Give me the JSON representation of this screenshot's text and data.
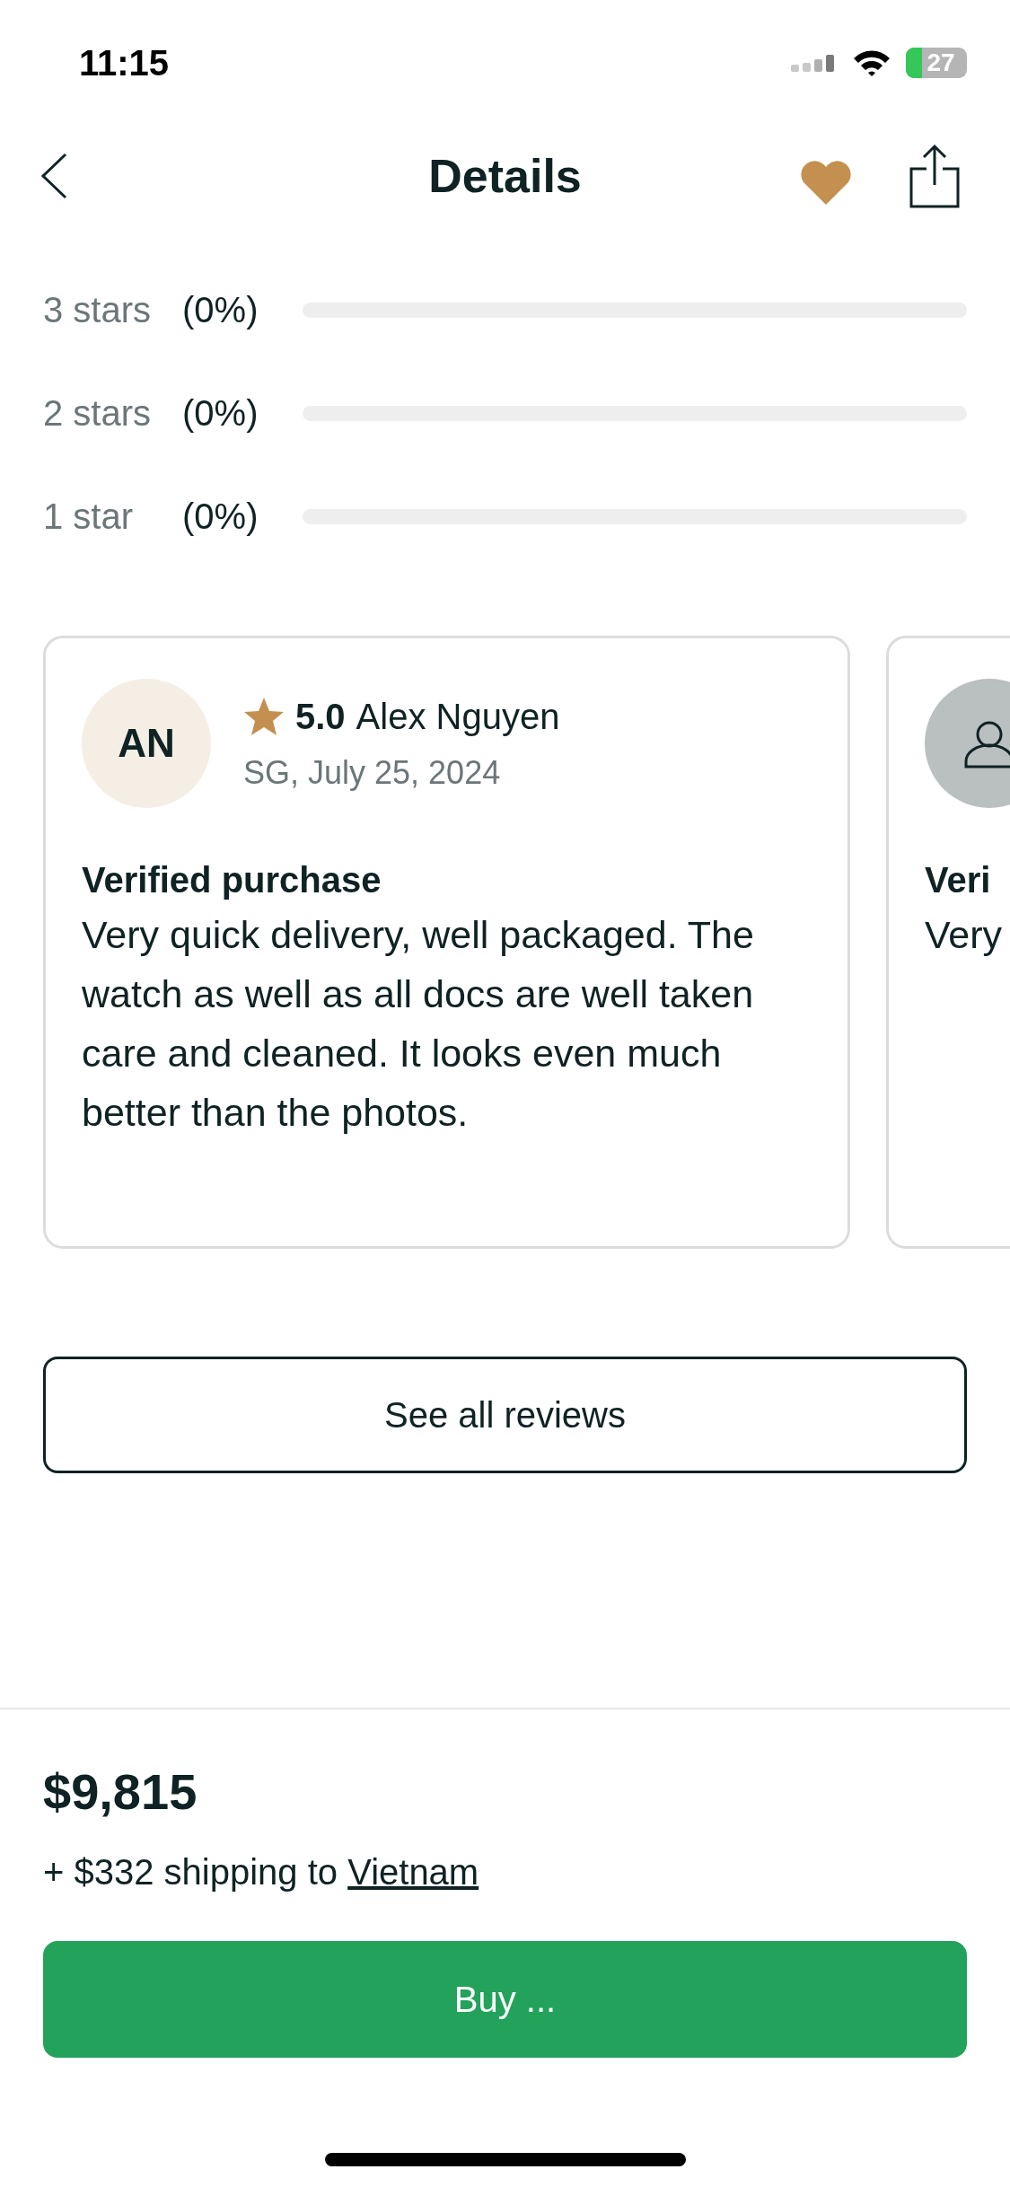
{
  "status_bar": {
    "time": "11:15",
    "battery": "27"
  },
  "nav": {
    "title": "Details",
    "favorite": true
  },
  "rating_breakdown": [
    {
      "label": "3 stars",
      "percent": "(0%)",
      "level": 0
    },
    {
      "label": "2 stars",
      "percent": "(0%)",
      "level": 0
    },
    {
      "label": "1 star",
      "percent": "(0%)",
      "level": 0
    }
  ],
  "reviews": [
    {
      "kind": "initials",
      "initials": "AN",
      "rating": "5.0",
      "name": "Alex Nguyen",
      "meta": "SG, July 25, 2024",
      "heading": "Verified purchase",
      "body": "Very quick delivery, well packaged. The watch as well as all docs are well taken care and cleaned. It looks even much better than the photos."
    },
    {
      "kind": "silhouette",
      "heading": "Veri",
      "body": "Very"
    }
  ],
  "see_all_button": "See all reviews",
  "price": "$9,815",
  "shipping": {
    "text": "+ $332 shipping to ",
    "destination": "Vietnam"
  },
  "buy_button": "Buy ..."
}
